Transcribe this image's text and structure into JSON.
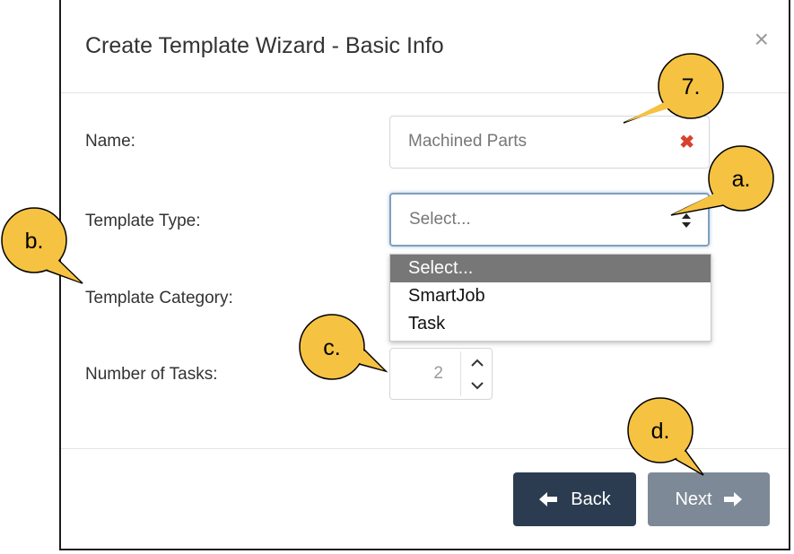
{
  "dialog": {
    "title": "Create Template Wizard - Basic Info",
    "close_glyph": "×"
  },
  "form": {
    "name_label": "Name:",
    "name_value": "Machined Parts",
    "clear_glyph": "✖",
    "type_label": "Template Type:",
    "type_placeholder": "Select...",
    "type_options": [
      "Select...",
      "SmartJob",
      "Task"
    ],
    "category_label": "Template Category:",
    "tasks_label": "Number of Tasks:",
    "tasks_value": "2"
  },
  "footer": {
    "back_label": "Back",
    "next_label": "Next"
  },
  "callouts": {
    "seven": "7.",
    "a": "a.",
    "b": "b.",
    "c": "c.",
    "d": "d."
  },
  "colors": {
    "callout_fill": "#f5c242",
    "back_button": "#2b3c50",
    "next_button": "#7d8996",
    "selected_option": "#777777",
    "clear_icon": "#d9412e"
  }
}
